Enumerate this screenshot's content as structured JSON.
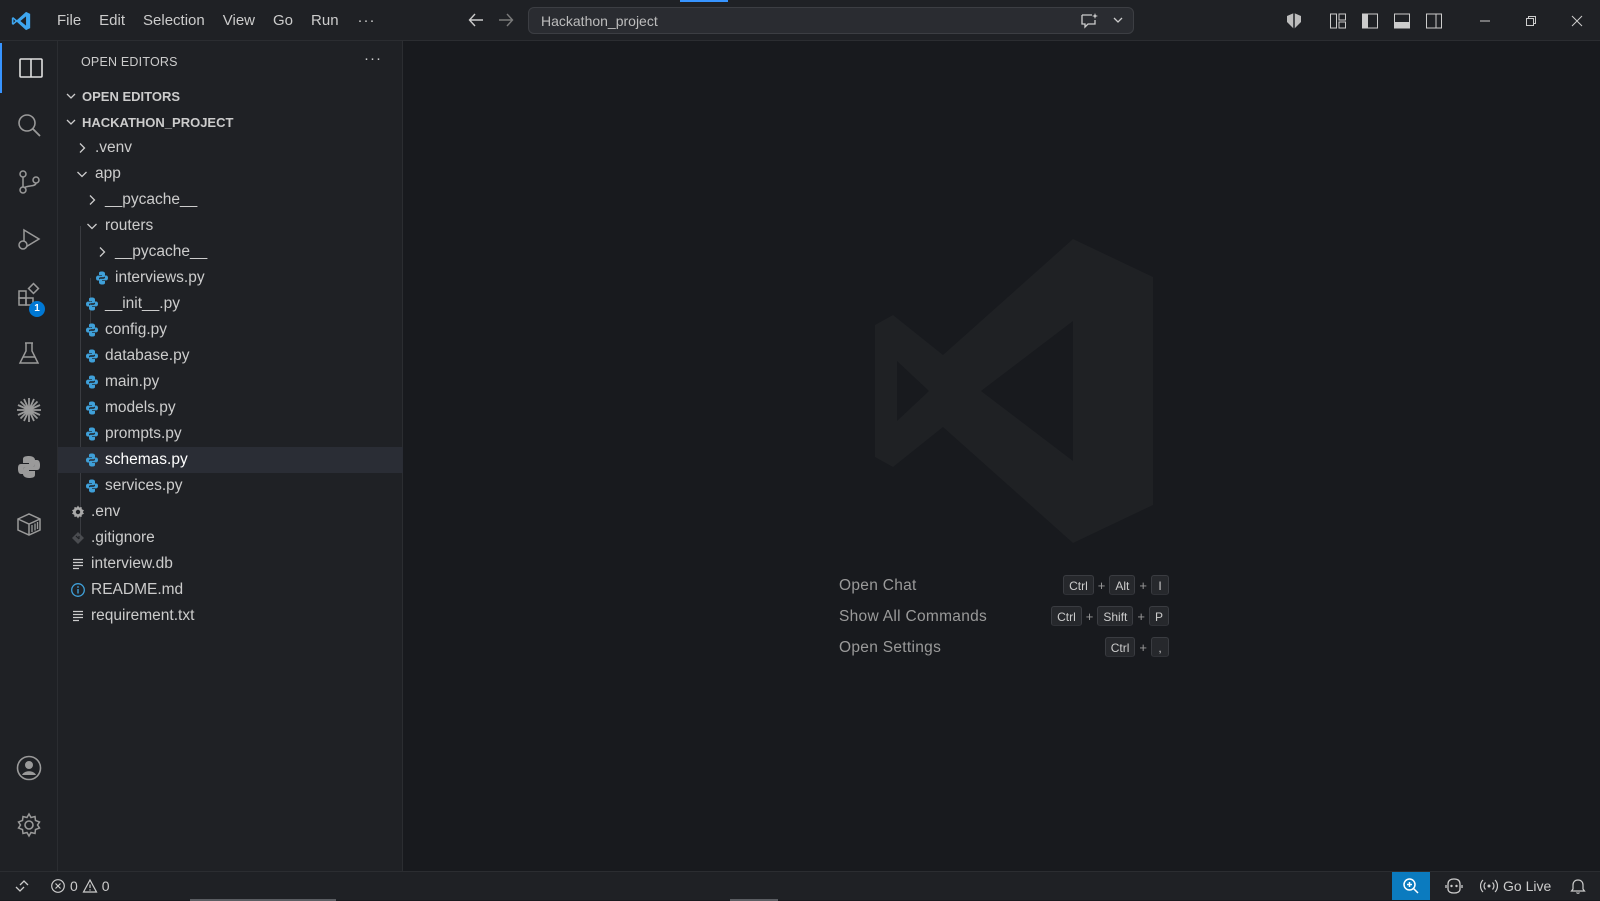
{
  "titlebar": {
    "menu": [
      "File",
      "Edit",
      "Selection",
      "View",
      "Go",
      "Run"
    ],
    "menu_more": "···",
    "search_text": "Hackathon_project"
  },
  "activitybar": {
    "items": [
      "explorer-icon",
      "search-icon",
      "source-control-icon",
      "run-debug-icon",
      "extensions-icon",
      "testing-icon",
      "asterisk-icon",
      "python-icon",
      "package-icon"
    ],
    "extensions_badge": "1",
    "bottom": [
      "accounts-icon",
      "settings-gear-icon"
    ]
  },
  "sidebar": {
    "header": "OPEN EDITORS",
    "header_more": "···",
    "open_editors_title": "OPEN EDITORS",
    "project_title": "HACKATHON_PROJECT",
    "tree": {
      "venv": ".venv",
      "app": "app",
      "pycache1": "__pycache__",
      "routers": "routers",
      "pycache2": "__pycache__",
      "interviews": "interviews.py",
      "init": "__init__.py",
      "config": "config.py",
      "database": "database.py",
      "main": "main.py",
      "models": "models.py",
      "prompts": "prompts.py",
      "schemas": "schemas.py",
      "services": "services.py",
      "env": ".env",
      "gitignore": ".gitignore",
      "interview_db": "interview.db",
      "readme": "README.md",
      "requirement": "requirement.txt"
    }
  },
  "editor": {
    "shortcuts": [
      {
        "label": "Open Chat",
        "keys": [
          "Ctrl",
          "Alt",
          "I"
        ]
      },
      {
        "label": "Show All Commands",
        "keys": [
          "Ctrl",
          "Shift",
          "P"
        ]
      },
      {
        "label": "Open Settings",
        "keys": [
          "Ctrl",
          ","
        ]
      }
    ],
    "plus": "+"
  },
  "statusbar": {
    "errors": "0",
    "warnings": "0",
    "go_live": "Go Live"
  },
  "colors": {
    "accent": "#3794ff",
    "python_icon": "#3fa0d9",
    "badge": "#0078d4",
    "zoom_bg": "#0b7bbf"
  }
}
